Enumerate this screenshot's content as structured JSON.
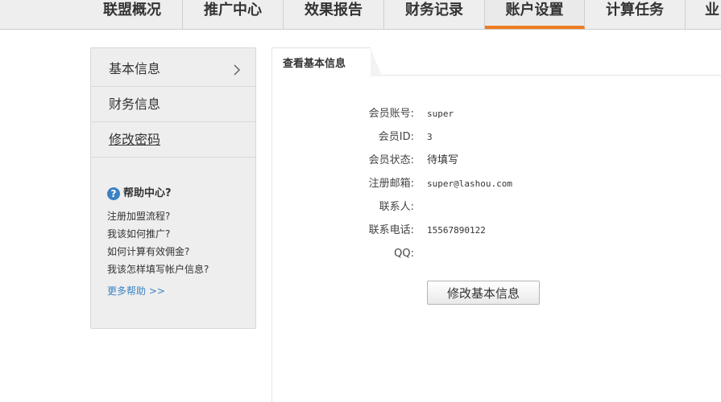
{
  "nav": {
    "tabs": [
      {
        "label": "联盟概况"
      },
      {
        "label": "推广中心"
      },
      {
        "label": "效果报告"
      },
      {
        "label": "财务记录"
      },
      {
        "label": "账户设置",
        "active": true
      },
      {
        "label": "计算任务"
      },
      {
        "label": "业"
      }
    ],
    "accent_color": "#f07c1f"
  },
  "sidebar": {
    "items": [
      {
        "label": "基本信息",
        "icon": "chevron-right-icon"
      },
      {
        "label": "财务信息"
      },
      {
        "label": "修改密码"
      }
    ],
    "help": {
      "icon": "question-circle-icon",
      "title": "帮助中心?",
      "links": [
        "注册加盟流程?",
        "我该如何推广?",
        "如何计算有效佣金?",
        "我该怎样填写帐户信息?"
      ],
      "more": "更多帮助 >>"
    }
  },
  "main": {
    "tab_label": "查看基本信息",
    "fields": [
      {
        "label": "会员账号:",
        "value": "super"
      },
      {
        "label": "会员ID:",
        "value": "3"
      },
      {
        "label": "会员状态:",
        "value": "待填写"
      },
      {
        "label": "注册邮箱:",
        "value": "super@lashou.com"
      },
      {
        "label": "联系人:",
        "value": ""
      },
      {
        "label": "联系电话:",
        "value": "15567890122"
      },
      {
        "label": "QQ:",
        "value": ""
      }
    ],
    "edit_button": "修改基本信息"
  }
}
